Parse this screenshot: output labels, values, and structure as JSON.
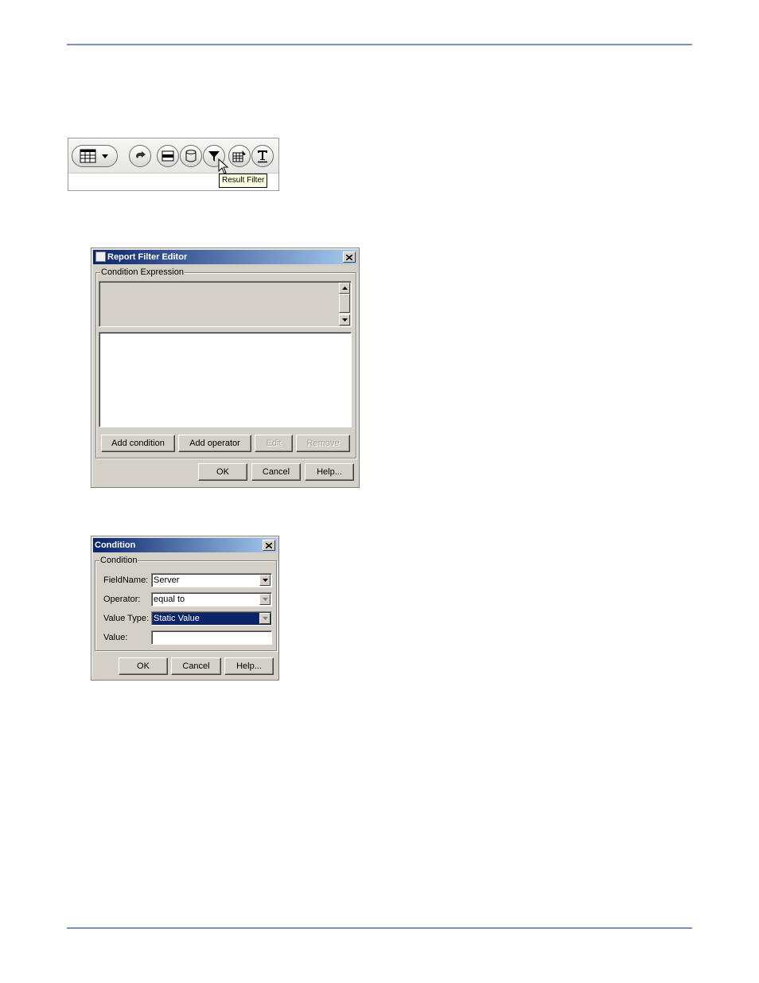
{
  "toolbar": {
    "tooltip": "Result Filter",
    "buttons": [
      "table-dropdown-icon",
      "undo-icon",
      "layout-icon",
      "database-icon",
      "filter-icon",
      "spreadsheet-edit-icon",
      "text-icon"
    ]
  },
  "filter_editor": {
    "title": "Report Filter Editor",
    "group_label": "Condition Expression",
    "buttons": {
      "add_condition": "Add condition",
      "add_operator": "Add operator",
      "edit": "Edit",
      "remove": "Remove"
    },
    "footer": {
      "ok": "OK",
      "cancel": "Cancel",
      "help": "Help..."
    }
  },
  "condition_dialog": {
    "title": "Condition",
    "group_label": "Condition",
    "fields": [
      {
        "label": "FieldName:",
        "value": "Server"
      },
      {
        "label": "Operator:",
        "value": "equal to"
      },
      {
        "label": "Value Type:",
        "value": "Static Value"
      },
      {
        "label": "Value:",
        "value": ""
      }
    ],
    "footer": {
      "ok": "OK",
      "cancel": "Cancel",
      "help": "Help..."
    }
  },
  "colors": {
    "titlebar": "#0a246a",
    "rule": "#7f8fb8",
    "dialog_bg": "#d4d0c8",
    "tooltip_bg": "#ffffe1"
  }
}
